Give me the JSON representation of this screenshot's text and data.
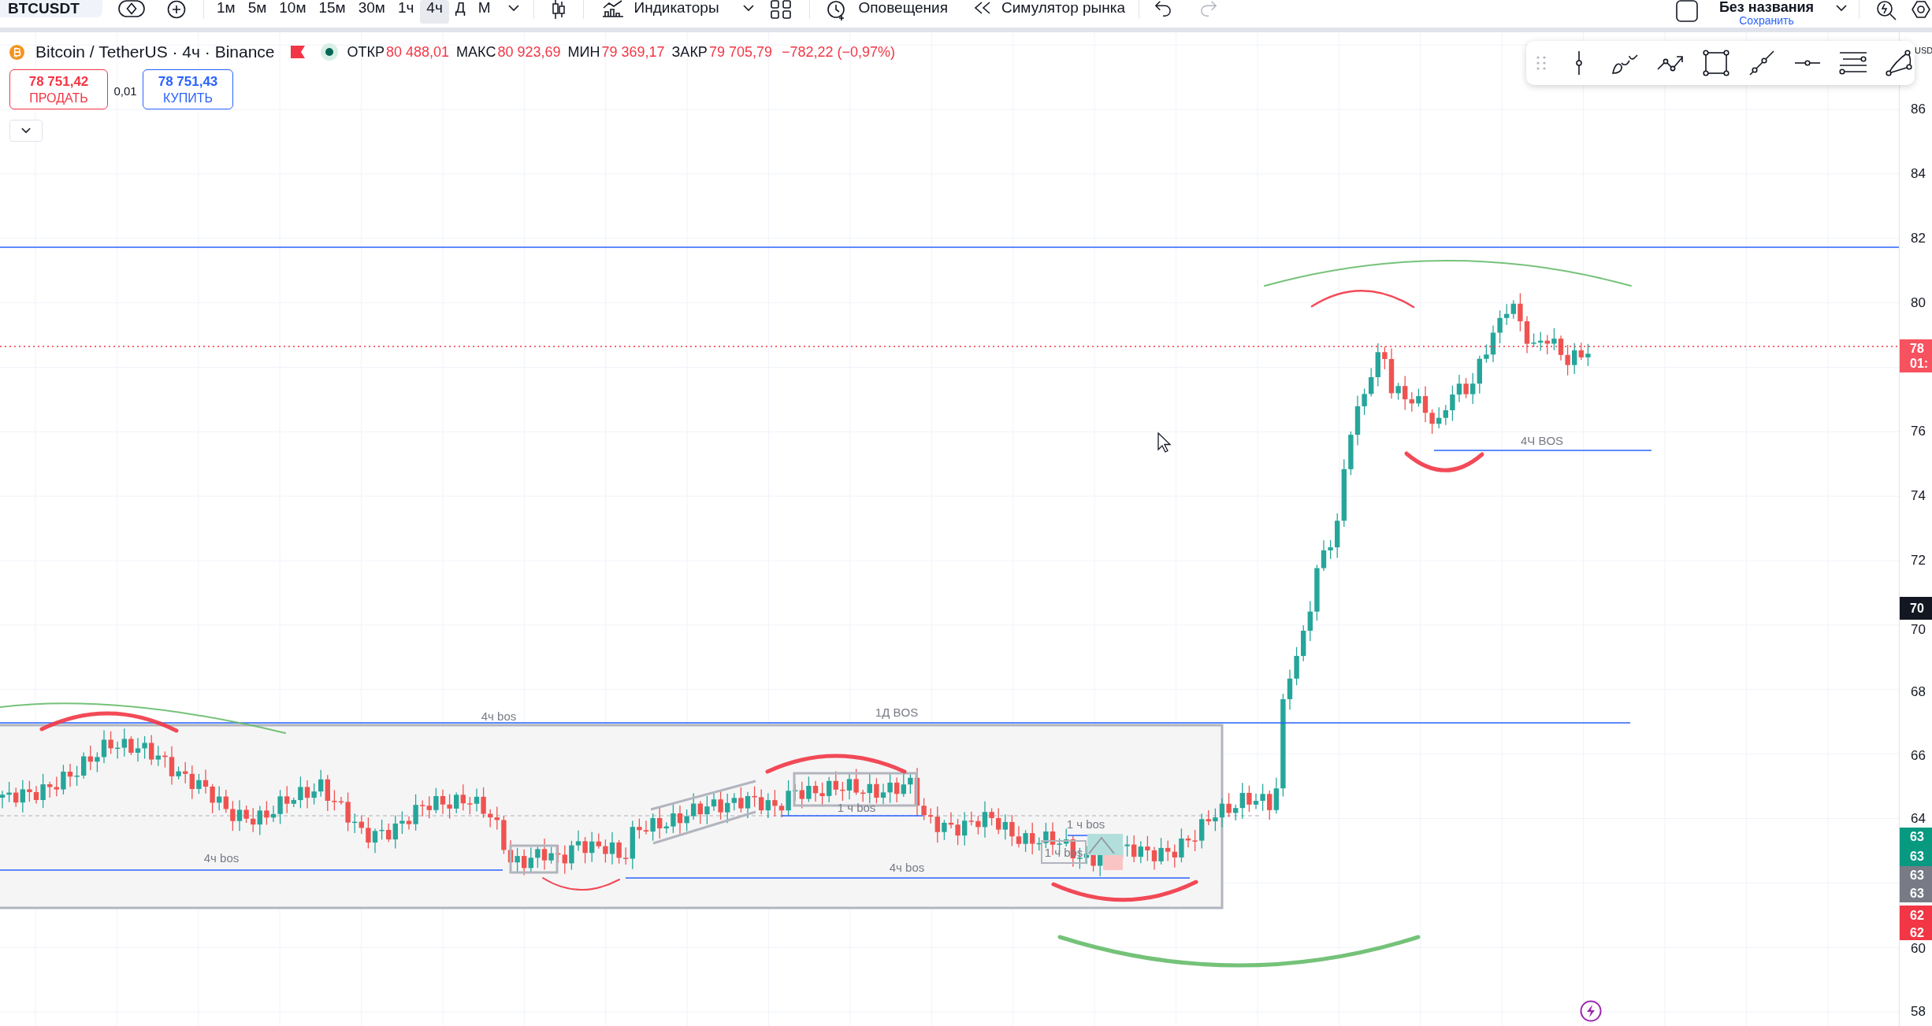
{
  "toolbar": {
    "symbol": "BTCUSDT",
    "intervals": [
      {
        "label": "1м",
        "selected": false
      },
      {
        "label": "5м",
        "selected": false
      },
      {
        "label": "10м",
        "selected": false
      },
      {
        "label": "15м",
        "selected": false
      },
      {
        "label": "30м",
        "selected": false
      },
      {
        "label": "1ч",
        "selected": false
      },
      {
        "label": "4ч",
        "selected": true
      },
      {
        "label": "Д",
        "selected": false
      },
      {
        "label": "М",
        "selected": false
      }
    ],
    "indicators": "Индикаторы",
    "alerts": "Оповещения",
    "replay": "Симулятор рынка",
    "history": [
      {
        "kind": "undo",
        "disabled": false
      },
      {
        "kind": "redo",
        "disabled": true
      }
    ],
    "layout_name": "Без названия",
    "save": "Сохранить"
  },
  "legend": {
    "title": "Bitcoin / TetherUS · 4ч · Binance",
    "values": [
      {
        "label": "ОТКР",
        "value": "80 488,01"
      },
      {
        "label": "МАКС",
        "value": "80 923,69"
      },
      {
        "label": "МИН",
        "value": "79 369,17"
      },
      {
        "label": "ЗАКР",
        "value": "79 705,79"
      }
    ],
    "change": "−782,22 (−0,97%)"
  },
  "trade": {
    "sell": {
      "price": "78 751,42",
      "label": "ПРОДАТЬ"
    },
    "spread": "0,01",
    "buy": {
      "price": "78 751,43",
      "label": "КУПИТЬ"
    }
  },
  "chart": {
    "labels": [
      "4Ч BOS",
      "1Д BOS",
      "4ч bos",
      "1 ч bos",
      "1 ч bos",
      "1 ч bos",
      "4ч bos",
      "4ч bos"
    ]
  },
  "price_axis": {
    "currency": "USD",
    "ticks": [
      "86",
      "84",
      "82",
      "80",
      "76",
      "74",
      "72",
      "70",
      "68",
      "66",
      "64",
      "60",
      "58"
    ],
    "tags": [
      {
        "lines": [
          "78",
          "01:"
        ],
        "color": "#f7525f"
      },
      {
        "lines": [
          "70"
        ],
        "color": "#131722"
      },
      {
        "lines": [
          "63"
        ],
        "color": "#089981"
      },
      {
        "lines": [
          "63"
        ],
        "color": "#089981"
      },
      {
        "lines": [
          "63"
        ],
        "color": "#787b86"
      },
      {
        "lines": [
          "63"
        ],
        "color": "#787b86"
      },
      {
        "lines": [
          "62"
        ],
        "color": "#f23645"
      },
      {
        "lines": [
          "62"
        ],
        "color": "#f23645"
      }
    ]
  }
}
